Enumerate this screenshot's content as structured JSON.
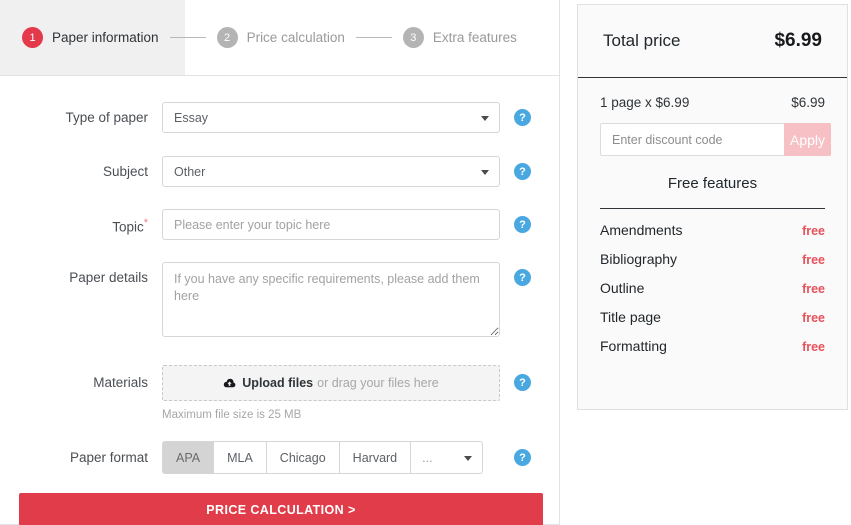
{
  "steps": {
    "items": [
      {
        "num": "1",
        "label": "Paper information",
        "active": true
      },
      {
        "num": "2",
        "label": "Price calculation",
        "active": false
      },
      {
        "num": "3",
        "label": "Extra features",
        "active": false
      }
    ]
  },
  "form": {
    "type_of_paper": {
      "label": "Type of paper",
      "value": "Essay"
    },
    "subject": {
      "label": "Subject",
      "value": "Other"
    },
    "topic": {
      "label": "Topic",
      "required_mark": "*",
      "placeholder": "Please enter your topic here",
      "value": ""
    },
    "paper_details": {
      "label": "Paper details",
      "placeholder": "If you have any specific requirements, please add them here",
      "value": ""
    },
    "materials": {
      "label": "Materials",
      "upload_bold": "Upload files",
      "upload_rest": "or drag your files here",
      "hint": "Maximum file size is 25 MB",
      "icon": "cloud-upload-icon"
    },
    "paper_format": {
      "label": "Paper format",
      "options": [
        "APA",
        "MLA",
        "Chicago",
        "Harvard"
      ],
      "selected": "APA",
      "more_label": "..."
    },
    "help_icon": "?"
  },
  "cta": {
    "label": "PRICE CALCULATION >"
  },
  "summary": {
    "total_label": "Total price",
    "total_value": "$6.99",
    "line_item_label": "1 page x $6.99",
    "line_item_value": "$6.99",
    "discount_placeholder": "Enter discount code",
    "discount_value": "",
    "apply_label": "Apply",
    "free_features_title": "Free features",
    "free_features": [
      {
        "name": "Amendments",
        "price": "free"
      },
      {
        "name": "Bibliography",
        "price": "free"
      },
      {
        "name": "Outline",
        "price": "free"
      },
      {
        "name": "Title page",
        "price": "free"
      },
      {
        "name": "Formatting",
        "price": "free"
      }
    ]
  },
  "colors": {
    "accent_red": "#e13c49",
    "step_active": "#e3394a",
    "help_blue": "#4aa8e0",
    "apply_pink": "#f6c0c4",
    "free_red": "#e8505b"
  }
}
